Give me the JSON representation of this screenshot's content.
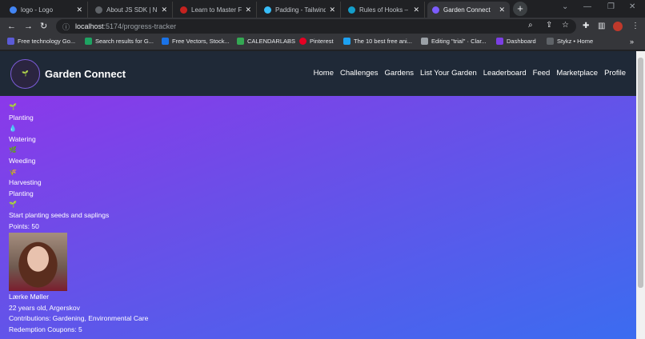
{
  "browser": {
    "tabs": [
      {
        "title": "logo - Logo",
        "color": "#4285f4"
      },
      {
        "title": "About JS SDK | NEAR",
        "color": "#202124"
      },
      {
        "title": "Learn to Master Fre",
        "color": "#c5221f"
      },
      {
        "title": "Padding - Tailwind C",
        "color": "#38bdf8"
      },
      {
        "title": "Rules of Hooks – Re",
        "color": "#149eca"
      },
      {
        "title": "Garden Connect",
        "color": "#7c5cff"
      }
    ],
    "url_host": "localhost",
    "url_path": ":5174/progress-tracker",
    "bookmarks": [
      {
        "label": "Free technology Go...",
        "color": "#5b5bd6"
      },
      {
        "label": "Search results for G...",
        "color": "#1ea362"
      },
      {
        "label": "Free Vectors, Stock...",
        "color": "#1a73e8"
      },
      {
        "label": "CALENDARLABS",
        "color": "#34a853"
      },
      {
        "label": "Pinterest",
        "color": "#e60023"
      },
      {
        "label": "The 10 best free ani...",
        "color": "#1da1f2"
      },
      {
        "label": "Editing \"trial\" · Clar...",
        "color": "#9aa0a6"
      },
      {
        "label": "Dashboard",
        "color": "#7b3fe4"
      },
      {
        "label": "Stykz • Home",
        "color": "#5f6368"
      }
    ]
  },
  "app": {
    "brand": "Garden Connect",
    "nav": [
      "Home",
      "Challenges",
      "Gardens",
      "List Your Garden",
      "Leaderboard",
      "Feed",
      "Marketplace",
      "Profile"
    ]
  },
  "tracker": {
    "steps": [
      {
        "icon": "🌱",
        "label": "Planting"
      },
      {
        "icon": "💧",
        "label": "Watering"
      },
      {
        "icon": "🌿",
        "label": "Weeding"
      },
      {
        "icon": "🌾",
        "label": "Harvesting"
      }
    ],
    "current": {
      "name": "Planting",
      "icon": "🌱",
      "description": "Start planting seeds and saplings",
      "points": "Points: 50"
    },
    "user": {
      "name": "Lærke Møller",
      "info": "22 years old, Argerskov",
      "contributions": "Contributions: Gardening, Environmental Care",
      "coupons": "Redemption Coupons: 5"
    }
  }
}
